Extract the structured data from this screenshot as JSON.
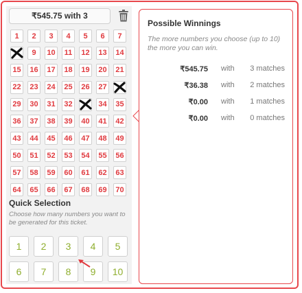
{
  "ticket": {
    "summary_label": "₹545.75 with 3"
  },
  "grid": {
    "numbers": [
      1,
      2,
      3,
      4,
      5,
      6,
      7,
      8,
      9,
      10,
      11,
      12,
      13,
      14,
      15,
      16,
      17,
      18,
      19,
      20,
      21,
      22,
      23,
      24,
      25,
      26,
      27,
      28,
      29,
      30,
      31,
      32,
      33,
      34,
      35,
      36,
      37,
      38,
      39,
      40,
      41,
      42,
      43,
      44,
      45,
      46,
      47,
      48,
      49,
      50,
      51,
      52,
      53,
      54,
      55,
      56,
      57,
      58,
      59,
      60,
      61,
      62,
      63,
      64,
      65,
      66,
      67,
      68,
      69,
      70
    ],
    "selected": [
      8,
      28,
      33
    ],
    "number_color": "#e03a3f"
  },
  "quick_selection": {
    "title": "Quick Selection",
    "description": "Choose how many numbers you want to be generated for this ticket.",
    "options": [
      "1",
      "2",
      "3",
      "4",
      "5",
      "6",
      "7",
      "8",
      "9",
      "10"
    ],
    "option_color": "#8fae2e"
  },
  "winnings": {
    "title": "Possible Winnings",
    "description": "The more numbers you choose (up to 10) the more you can win.",
    "rows": [
      {
        "amount": "₹545.75",
        "with": "with",
        "matches": "3 matches"
      },
      {
        "amount": "₹36.38",
        "with": "with",
        "matches": "2 matches"
      },
      {
        "amount": "₹0.00",
        "with": "with",
        "matches": "1 matches"
      },
      {
        "amount": "₹0.00",
        "with": "with",
        "matches": "0 matches"
      }
    ]
  },
  "theme": {
    "accent": "#e8474c",
    "background_left": "#f2f2f2"
  }
}
